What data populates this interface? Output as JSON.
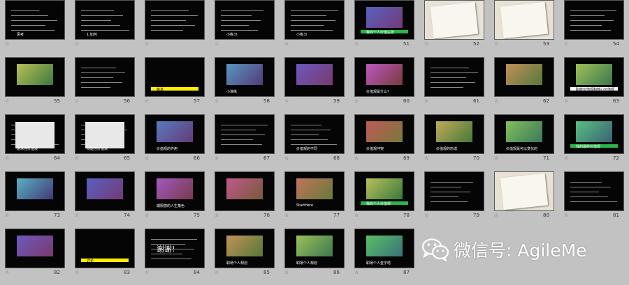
{
  "slides": [
    {
      "id": "s1",
      "num": "",
      "title": "思考",
      "bar_color": "",
      "kind": "text"
    },
    {
      "id": "s2",
      "num": "",
      "title": "1.如何",
      "bar_color": "",
      "kind": "text"
    },
    {
      "id": "s3",
      "num": "",
      "title": "",
      "bar_color": "",
      "kind": "text"
    },
    {
      "id": "s4",
      "num": "",
      "title": "小练习",
      "bar_color": "",
      "kind": "text"
    },
    {
      "id": "s5",
      "num": "",
      "title": "小练习",
      "bar_color": "",
      "kind": "text"
    },
    {
      "id": "s6",
      "num": "51",
      "title": "我的个人价值主张",
      "bar_color": "#2bb54a",
      "kind": "image"
    },
    {
      "id": "s7",
      "num": "52",
      "title": "",
      "bar_color": "",
      "kind": "paper"
    },
    {
      "id": "s8",
      "num": "53",
      "title": "",
      "bar_color": "",
      "kind": "paper"
    },
    {
      "id": "s9",
      "num": "54",
      "title": "",
      "bar_color": "",
      "kind": "text"
    },
    {
      "id": "s10",
      "num": "55",
      "title": "",
      "bar_color": "",
      "kind": "image"
    },
    {
      "id": "s11",
      "num": "56",
      "title": "",
      "bar_color": "",
      "kind": "text"
    },
    {
      "id": "s12",
      "num": "57",
      "title": "休息",
      "bar_color": "#ffee00",
      "kind": "bar"
    },
    {
      "id": "s13",
      "num": "58",
      "title": "小演练",
      "bar_color": "",
      "kind": "image"
    },
    {
      "id": "s14",
      "num": "59",
      "title": "",
      "bar_color": "",
      "kind": "image"
    },
    {
      "id": "s15",
      "num": "60",
      "title": "价值观是什么?",
      "bar_color": "",
      "kind": "image"
    },
    {
      "id": "s16",
      "num": "61",
      "title": "",
      "bar_color": "",
      "kind": "text"
    },
    {
      "id": "s17",
      "num": "62",
      "title": "",
      "bar_color": "",
      "kind": "image"
    },
    {
      "id": "s18",
      "num": "63",
      "title": "职能价值观和核心价值观",
      "bar_color": "#ffffff",
      "kind": "image"
    },
    {
      "id": "s19",
      "num": "64",
      "title": "追求性价值观",
      "bar_color": "",
      "kind": "table"
    },
    {
      "id": "s20",
      "num": "65",
      "title": "功能性价值观",
      "bar_color": "",
      "kind": "table"
    },
    {
      "id": "s21",
      "num": "66",
      "title": "价值观的作用",
      "bar_color": "",
      "kind": "image"
    },
    {
      "id": "s22",
      "num": "67",
      "title": "",
      "bar_color": "",
      "kind": "text"
    },
    {
      "id": "s23",
      "num": "68",
      "title": "价值观的不同",
      "bar_color": "",
      "kind": "text"
    },
    {
      "id": "s24",
      "num": "69",
      "title": "价值观冲突",
      "bar_color": "",
      "kind": "image"
    },
    {
      "id": "s25",
      "num": "70",
      "title": "价值观的形成",
      "bar_color": "",
      "kind": "image"
    },
    {
      "id": "s26",
      "num": "71",
      "title": "价值观是可以变化的",
      "bar_color": "",
      "kind": "image"
    },
    {
      "id": "s27",
      "num": "72",
      "title": "我的最终价值观",
      "bar_color": "#2bb54a",
      "kind": "image"
    },
    {
      "id": "s28",
      "num": "73",
      "title": "",
      "bar_color": "",
      "kind": "image"
    },
    {
      "id": "s29",
      "num": "74",
      "title": "",
      "bar_color": "",
      "kind": "image"
    },
    {
      "id": "s30",
      "num": "75",
      "title": "期限感的人生角色",
      "bar_color": "",
      "kind": "image"
    },
    {
      "id": "s31",
      "num": "76",
      "title": "",
      "bar_color": "",
      "kind": "image"
    },
    {
      "id": "s32",
      "num": "77",
      "title": "StartHere",
      "bar_color": "",
      "kind": "image"
    },
    {
      "id": "s33",
      "num": "78",
      "title": "我的个人价值观",
      "bar_color": "#2bb54a",
      "kind": "image"
    },
    {
      "id": "s34",
      "num": "79",
      "title": "",
      "bar_color": "",
      "kind": "text"
    },
    {
      "id": "s35",
      "num": "80",
      "title": "",
      "bar_color": "",
      "kind": "paper"
    },
    {
      "id": "s36",
      "num": "81",
      "title": "",
      "bar_color": "",
      "kind": "text"
    },
    {
      "id": "s37",
      "num": "82",
      "title": "",
      "bar_color": "",
      "kind": "image"
    },
    {
      "id": "s38",
      "num": "83",
      "title": "讨论",
      "bar_color": "#ffee00",
      "kind": "bar"
    },
    {
      "id": "s39",
      "num": "84",
      "title": "谢谢!",
      "bar_color": "",
      "kind": "text"
    },
    {
      "id": "s40",
      "num": "85",
      "title": "职场个人规划",
      "bar_color": "",
      "kind": "image"
    },
    {
      "id": "s41",
      "num": "86",
      "title": "职场个人规划",
      "bar_color": "",
      "kind": "image"
    },
    {
      "id": "s42",
      "num": "87",
      "title": "职场个人金字塔",
      "bar_color": "",
      "kind": "image"
    }
  ],
  "watermark": {
    "text": "微信号: AgileMe",
    "icon": "wechat-icon"
  }
}
